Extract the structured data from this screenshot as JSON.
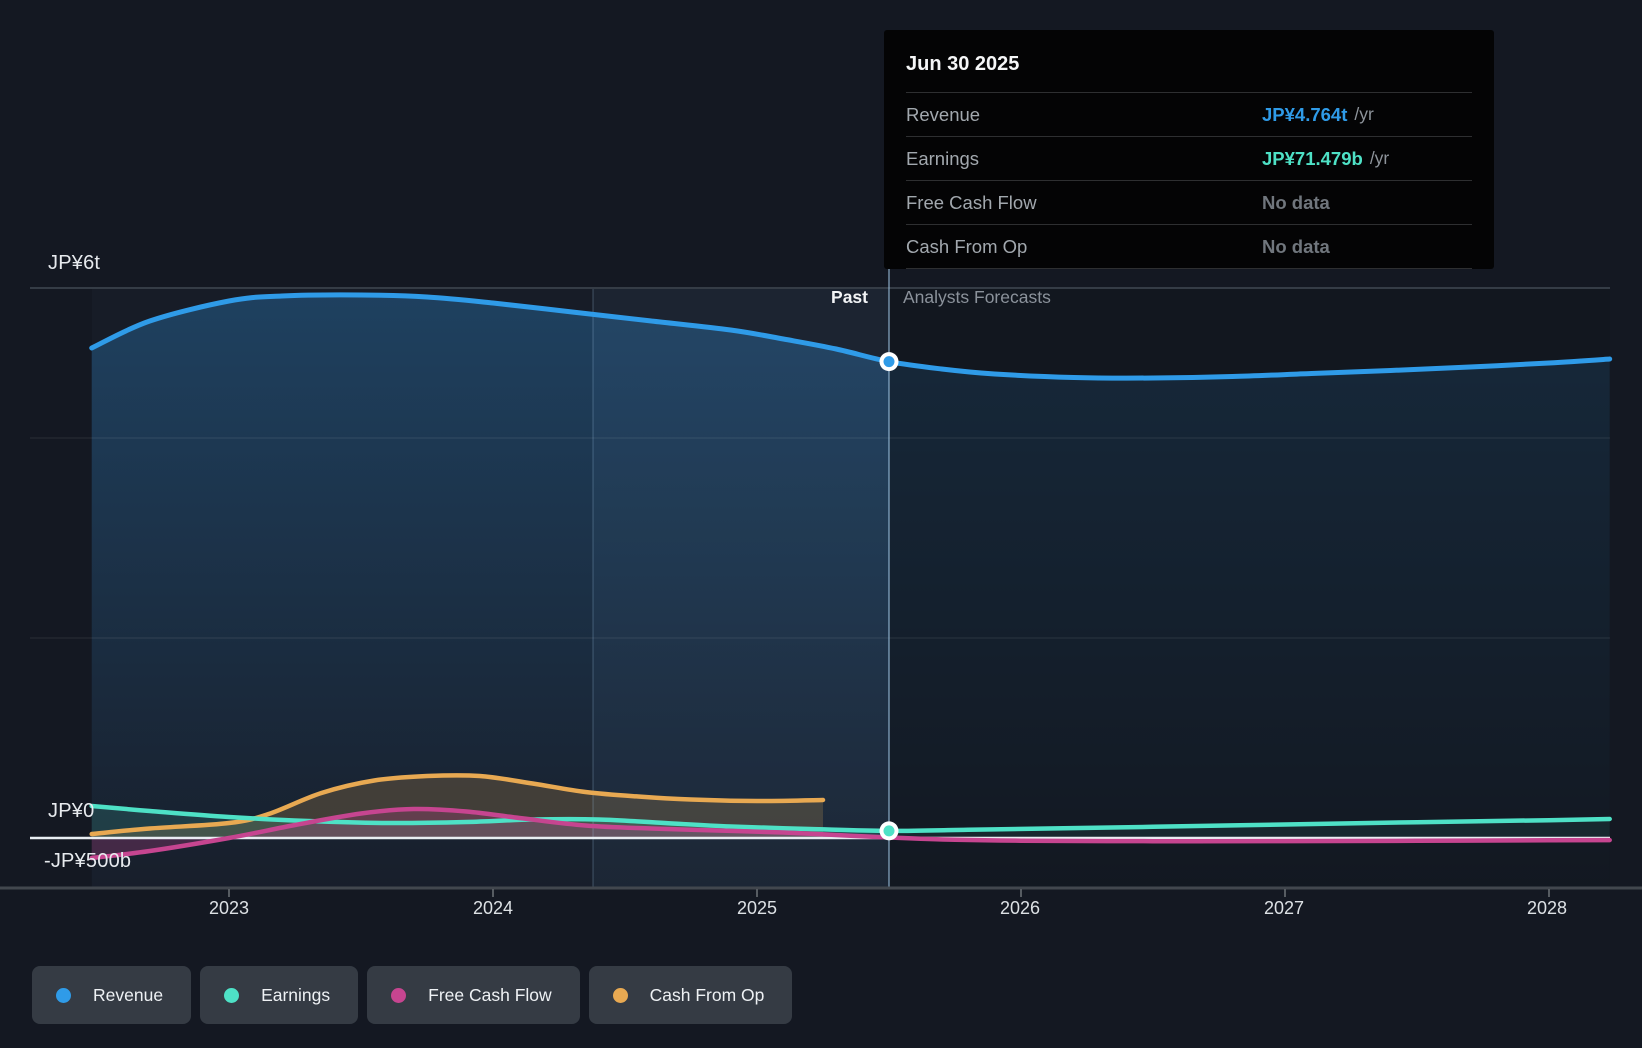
{
  "tooltip": {
    "date": "Jun 30 2025",
    "rows": [
      {
        "label": "Revenue",
        "value": "JP¥4.764t",
        "suffix": "/yr",
        "value_color": "#2F9BE8"
      },
      {
        "label": "Earnings",
        "value": "JP¥71.479b",
        "suffix": "/yr",
        "value_color": "#4EE1C6"
      },
      {
        "label": "Free Cash Flow",
        "value": "No data",
        "suffix": "",
        "value_color": "#70767D"
      },
      {
        "label": "Cash From Op",
        "value": "No data",
        "suffix": "",
        "value_color": "#70767D"
      }
    ]
  },
  "annotations": {
    "past": "Past",
    "forecast": "Analysts Forecasts"
  },
  "legend": [
    {
      "label": "Revenue",
      "color": "#2F9BE8"
    },
    {
      "label": "Earnings",
      "color": "#4EE1C6"
    },
    {
      "label": "Free Cash Flow",
      "color": "#C64590"
    },
    {
      "label": "Cash From Op",
      "color": "#E8A952"
    }
  ],
  "chart_data": {
    "type": "line",
    "unit": "JP¥ trillions per year",
    "ylim": [
      -0.5,
      6
    ],
    "y_tick_labels": [
      "JP¥6t",
      "JP¥0",
      "-JP¥500b"
    ],
    "x_tick_labels": [
      "2023",
      "2024",
      "2025",
      "2026",
      "2027",
      "2028"
    ],
    "x_range": [
      2022.48,
      2028.23
    ],
    "divider_year": 2025.5,
    "divider_date_label": "Jun 30 2025",
    "legend_position": "bottom",
    "grid": "horizontal-faint",
    "markers": [
      {
        "series": "Revenue",
        "year": 2025.5,
        "value": 4.764
      },
      {
        "series": "Earnings",
        "year": 2025.5,
        "value": 0.071479
      }
    ],
    "series": [
      {
        "name": "Revenue",
        "color": "#2F9BE8",
        "width": 5,
        "fill": "revenue-gradient",
        "base": 888,
        "points": [
          [
            2022.48,
            4.9
          ],
          [
            2022.7,
            5.17
          ],
          [
            2023.0,
            5.37
          ],
          [
            2023.2,
            5.42
          ],
          [
            2023.5,
            5.43
          ],
          [
            2023.75,
            5.41
          ],
          [
            2024.0,
            5.35
          ],
          [
            2024.3,
            5.26
          ],
          [
            2024.6,
            5.17
          ],
          [
            2024.9,
            5.08
          ],
          [
            2025.1,
            4.99
          ],
          [
            2025.3,
            4.89
          ],
          [
            2025.5,
            4.764
          ],
          [
            2025.7,
            4.69
          ],
          [
            2025.9,
            4.64
          ],
          [
            2026.2,
            4.605
          ],
          [
            2026.5,
            4.6
          ],
          [
            2026.8,
            4.615
          ],
          [
            2027.1,
            4.645
          ],
          [
            2027.4,
            4.675
          ],
          [
            2027.7,
            4.71
          ],
          [
            2028.0,
            4.75
          ],
          [
            2028.23,
            4.79
          ]
        ]
      },
      {
        "name": "Cash From Op",
        "color": "#E8A952",
        "width": 4.5,
        "fill": "rgba(232,169,82,0.20)",
        "base": 838,
        "points": [
          [
            2022.48,
            0.04
          ],
          [
            2022.7,
            0.095
          ],
          [
            2023.0,
            0.15
          ],
          [
            2023.15,
            0.24
          ],
          [
            2023.35,
            0.45
          ],
          [
            2023.55,
            0.575
          ],
          [
            2023.75,
            0.62
          ],
          [
            2023.95,
            0.62
          ],
          [
            2024.15,
            0.545
          ],
          [
            2024.35,
            0.46
          ],
          [
            2024.55,
            0.415
          ],
          [
            2024.75,
            0.385
          ],
          [
            2025.0,
            0.37
          ],
          [
            2025.25,
            0.38
          ]
        ]
      },
      {
        "name": "Earnings",
        "color": "#4EE1C6",
        "width": 4.5,
        "fill": "rgba(78,225,198,0.15)",
        "base": 838,
        "points": [
          [
            2022.48,
            0.32
          ],
          [
            2022.7,
            0.27
          ],
          [
            2023.0,
            0.21
          ],
          [
            2023.3,
            0.17
          ],
          [
            2023.6,
            0.15
          ],
          [
            2023.9,
            0.16
          ],
          [
            2024.15,
            0.185
          ],
          [
            2024.4,
            0.185
          ],
          [
            2024.65,
            0.15
          ],
          [
            2024.9,
            0.115
          ],
          [
            2025.2,
            0.09
          ],
          [
            2025.5,
            0.0715
          ],
          [
            2025.8,
            0.082
          ],
          [
            2026.1,
            0.095
          ],
          [
            2026.5,
            0.112
          ],
          [
            2027.0,
            0.135
          ],
          [
            2027.5,
            0.158
          ],
          [
            2028.0,
            0.178
          ],
          [
            2028.23,
            0.19
          ]
        ]
      },
      {
        "name": "Free Cash Flow",
        "color": "#C64590",
        "width": 4.5,
        "fill": "rgba(198,69,144,0.25)",
        "base": 838,
        "points": [
          [
            2022.48,
            -0.2
          ],
          [
            2022.7,
            -0.13
          ],
          [
            2023.0,
            0.0
          ],
          [
            2023.25,
            0.13
          ],
          [
            2023.5,
            0.245
          ],
          [
            2023.7,
            0.29
          ],
          [
            2023.9,
            0.265
          ],
          [
            2024.1,
            0.2
          ],
          [
            2024.35,
            0.125
          ],
          [
            2024.6,
            0.095
          ],
          [
            2024.85,
            0.075
          ],
          [
            2025.1,
            0.055
          ],
          [
            2025.3,
            0.03
          ],
          [
            2025.5,
            0.005
          ],
          [
            2025.75,
            -0.018
          ],
          [
            2026.0,
            -0.027
          ],
          [
            2026.5,
            -0.032
          ],
          [
            2027.0,
            -0.031
          ],
          [
            2027.5,
            -0.028
          ],
          [
            2028.0,
            -0.023
          ],
          [
            2028.23,
            -0.021
          ]
        ]
      }
    ]
  }
}
